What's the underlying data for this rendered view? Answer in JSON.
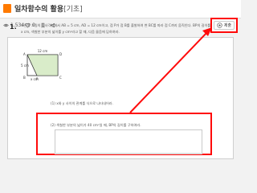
{
  "header": {
    "title": "일차함수의 활용",
    "subtitle": "[기초]"
  },
  "meta": {
    "views": "1,534",
    "likes": "0"
  },
  "actions": {
    "submit_label": "제출"
  },
  "question": {
    "number": "1.",
    "line1": "오른쪽 그림의 직사각형에서 AB = 5 cm, AD = 12 cm이고, 점 P가 점 B를 출발하여 변 BC를 따라 점 C까지 움직인다. BP의 길이를",
    "line2": "x cm, 색칠한 부분의 넓이를 y cm²라고 할 때, 다음 물음에 답하여라.",
    "sub1": "(1) x와 y 사이의 관계를 식으로 나타내어라.",
    "sub2": "(2) 색칠한 부분의 넓이가 40 cm²일 때, BP의 길이를 구하여라."
  },
  "figure": {
    "top_label": "12 cm",
    "side_label": "5 cm",
    "bottom_label": "x cm",
    "bottom_right_label": "P",
    "corner_a": "A",
    "corner_d": "D",
    "corner_b": "B",
    "corner_c": "C",
    "shade_color": "#d9ecc9"
  },
  "colors": {
    "accent": "#ff0a0a",
    "logo": "#ff7a00"
  }
}
